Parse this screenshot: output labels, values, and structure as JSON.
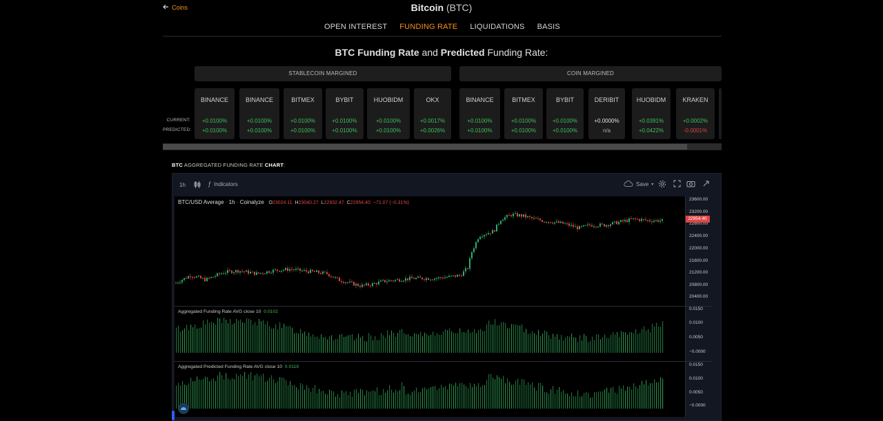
{
  "header": {
    "back_label": "Coins",
    "title_bold": "Bitcoin",
    "title_rest": "(BTC)"
  },
  "nav": {
    "tabs": [
      "OPEN INTEREST",
      "FUNDING RATE",
      "LIQUIDATIONS",
      "BASIS"
    ],
    "active": "FUNDING RATE"
  },
  "section_heading": {
    "p1": "BTC Funding Rate",
    "p2": " and ",
    "p3": "Predicted",
    "p4": " Funding Rate:"
  },
  "groups": {
    "stablecoin": "STABLECOIN MARGINED",
    "coin": "COIN MARGINED"
  },
  "row_labels": {
    "current": "CURRENT:",
    "predicted": "PREDICTED:"
  },
  "exchanges": [
    {
      "name": "BINANCE",
      "current": "+0.0100%",
      "predicted": "+0.0100%",
      "cur_color": "g",
      "pre_color": "g"
    },
    {
      "name": "BINANCE",
      "current": "+0.0100%",
      "predicted": "+0.0100%",
      "cur_color": "g",
      "pre_color": "g"
    },
    {
      "name": "BITMEX",
      "current": "+0.0100%",
      "predicted": "+0.0100%",
      "cur_color": "g",
      "pre_color": "g"
    },
    {
      "name": "BYBIT",
      "current": "+0.0100%",
      "predicted": "+0.0100%",
      "cur_color": "g",
      "pre_color": "g"
    },
    {
      "name": "HUOBIDM",
      "current": "+0.0100%",
      "predicted": "+0.0100%",
      "cur_color": "g",
      "pre_color": "g"
    },
    {
      "name": "OKX",
      "current": "+0.0017%",
      "predicted": "+0.0026%",
      "cur_color": "g",
      "pre_color": "g"
    },
    {
      "name": "BINANCE",
      "current": "+0.0100%",
      "predicted": "+0.0100%",
      "cur_color": "g",
      "pre_color": "g"
    },
    {
      "name": "BITMEX",
      "current": "+0.0100%",
      "predicted": "+0.0100%",
      "cur_color": "g",
      "pre_color": "g"
    },
    {
      "name": "BYBIT",
      "current": "+0.0100%",
      "predicted": "+0.0100%",
      "cur_color": "g",
      "pre_color": "g"
    },
    {
      "name": "DERIBIT",
      "current": "+0.0000%",
      "predicted": "n/a",
      "cur_color": "w",
      "pre_color": "gr"
    },
    {
      "name": "HUOBIDM",
      "current": "+0.0391%",
      "predicted": "+0.0422%",
      "cur_color": "g",
      "pre_color": "g"
    },
    {
      "name": "KRAKEN",
      "current": "+0.0002%",
      "predicted": "-0.0001%",
      "cur_color": "g",
      "pre_color": "r"
    }
  ],
  "agg_label": {
    "b1": "BTC",
    "mid": " AGGREGATED FUNDING RATE ",
    "b2": "CHART",
    "end": ":"
  },
  "toolbar": {
    "interval": "1h",
    "indicators": "Indicators",
    "save": "Save"
  },
  "main_legend": {
    "symbol": "BTC/USD Average",
    "interval": "1h",
    "source": "Coinalyze",
    "o_label": "O",
    "o": "23024.11",
    "h_label": "H",
    "h": "23040.27",
    "l_label": "L",
    "l": "22932.47",
    "c_label": "C",
    "c": "22954.40",
    "change": "−71.07 (−0.31%)"
  },
  "price_axis": [
    "23600.00",
    "23200.00",
    "22800.00",
    "22400.00",
    "22000.00",
    "21600.00",
    "21200.00",
    "20800.00",
    "20400.00"
  ],
  "last_price": "22954.40",
  "pane2": {
    "title": "Aggregated Funding Rate AVG close 10",
    "value": "0.0102",
    "axis": [
      "0.0150",
      "0.0100",
      "0.0050",
      "−0.0000"
    ]
  },
  "pane3": {
    "title": "Aggregated Predicted Funding Rate AVG close 10",
    "value": "0.0119",
    "axis": [
      "0.0150",
      "0.0100",
      "0.0050",
      "−0.0000"
    ]
  },
  "colors": {
    "accent": "#f7941d",
    "up": "#3fbf5a",
    "down": "#e04545",
    "chart_bg": "#131722"
  },
  "icons": [
    "arrow-left-icon",
    "candles-icon",
    "fx-icon",
    "cloud-icon",
    "gear-icon",
    "fullscreen-icon",
    "camera-icon",
    "publish-icon",
    "coinalyze-logo-icon"
  ]
}
